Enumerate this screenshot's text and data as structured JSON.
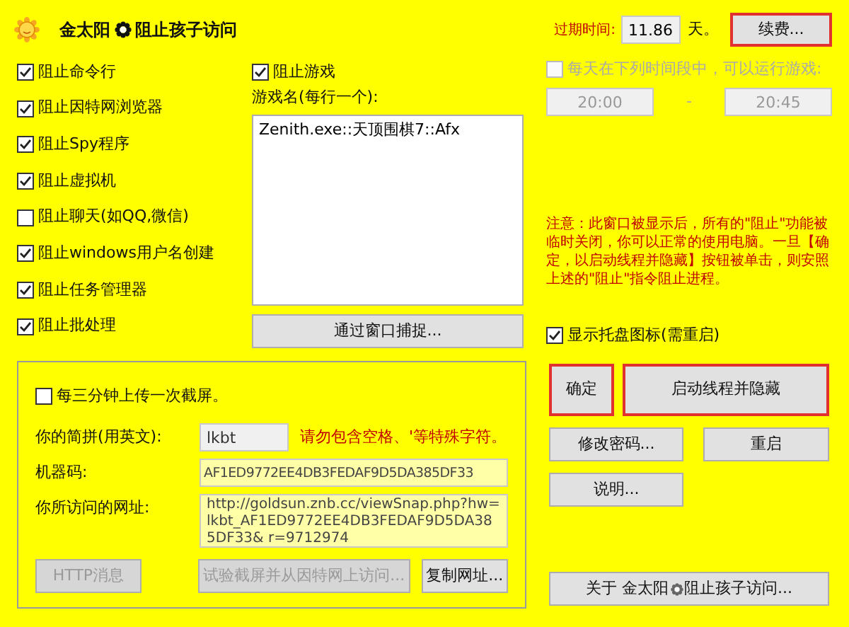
{
  "window": {
    "title_left": "金太阳",
    "title_right": "阻止孩子访问"
  },
  "expiry": {
    "label": "过期时间:",
    "value": "11.86",
    "unit": "天。",
    "button": "续费..."
  },
  "block_options": [
    {
      "label": "阻止命令行",
      "checked": true
    },
    {
      "label": "阻止因特网浏览器",
      "checked": true
    },
    {
      "label": "阻止Spy程序",
      "checked": true
    },
    {
      "label": "阻止虚拟机",
      "checked": true
    },
    {
      "label": "阻止聊天(如QQ,微信)",
      "checked": false
    },
    {
      "label": "阻止windows用户名创建",
      "checked": true
    },
    {
      "label": "阻止任务管理器",
      "checked": true
    },
    {
      "label": "阻止批处理",
      "checked": true
    }
  ],
  "games": {
    "label": "阻止游戏",
    "checked": true,
    "list_label": "游戏名(每行一个):",
    "list": "Zenith.exe::天顶围棋7::Afx",
    "capture_button": "通过窗口捕捉..."
  },
  "schedule": {
    "label": "每天在下列时间段中，可以运行游戏:",
    "checked": false,
    "disabled": true,
    "start": "20:00",
    "separator": "-",
    "end": "20:45"
  },
  "notice": "注意：此窗口被显示后，所有的\"阻止\"功能被临时关闭，你可以正常的使用电脑。一旦【确定，以启动线程并隐藏】按钮被单击，则安照上述的\"阻止\"指令阻止进程。",
  "tray": {
    "label": "显示托盘图标(需重启)",
    "checked": true
  },
  "screenshot": {
    "label": "每三分钟上传一次截屏。",
    "checked": false,
    "nick": {
      "label": "你的简拼(用英文):",
      "value": "lkbt",
      "hint": "请勿包含空格、'等特殊字符。"
    },
    "machine": {
      "label": "机器码:",
      "value": "AF1ED9772EE4DB3FEDAF9D5DA385DF33"
    },
    "url": {
      "label": "你所访问的网址:",
      "value": "http://goldsun.znb.cc/viewSnap.php?hw=lkbt_AF1ED9772EE4DB3FEDAF9D5DA385DF33& r=9712974"
    },
    "buttons": [
      {
        "label": "HTTP消息",
        "disabled": true
      },
      {
        "label": "试验截屏并从因特网上访问...",
        "disabled": true
      },
      {
        "label": "复制网址...",
        "disabled": false
      }
    ]
  },
  "actions": [
    {
      "label": "确定",
      "highlighted": true
    },
    {
      "label": "启动线程并隐藏",
      "highlighted": true
    },
    {
      "label": "修改密码...",
      "highlighted": false
    },
    {
      "label": "重启",
      "highlighted": false
    },
    {
      "label": "说明...",
      "highlighted": false
    }
  ],
  "about_button": {
    "prefix": "关于 金太阳",
    "suffix": "阻止孩子访问..."
  }
}
